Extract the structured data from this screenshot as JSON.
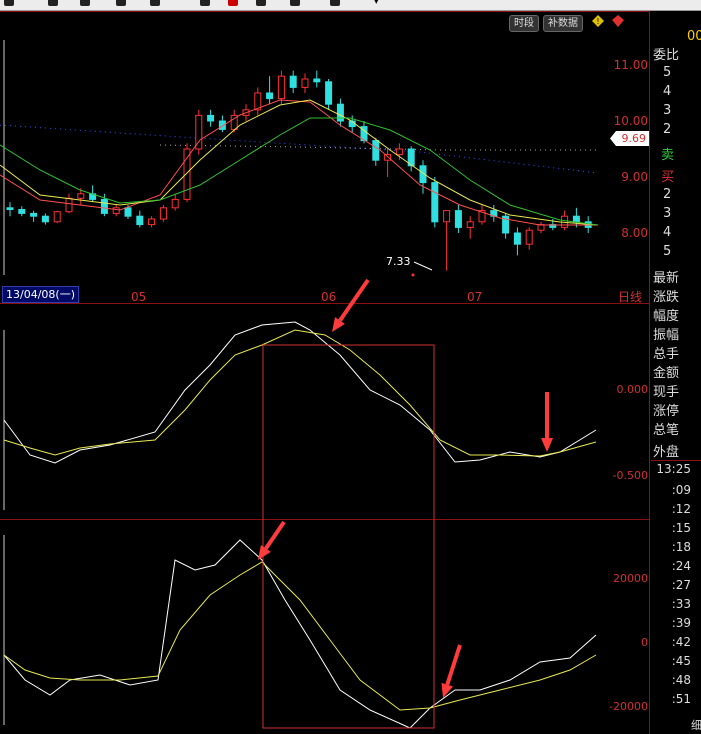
{
  "toolbar": {
    "caret": "▾"
  },
  "header_buttons": {
    "timeshare": "时段",
    "supplement": "补数据"
  },
  "stock_code": "00",
  "price_axis": [
    "11.00",
    "10.00",
    "9.00",
    "8.00"
  ],
  "current_price": "9.69",
  "min_price_label": "7.33",
  "date_box": "13/04/08(一)",
  "month_labels": [
    "05",
    "06",
    "07"
  ],
  "period_label": "日线",
  "ind1_axis": [
    "0.000",
    "-0.500"
  ],
  "ind2_axis": [
    "20000",
    "0",
    "-20000"
  ],
  "side_panel": {
    "weibi": "委比",
    "sell_levels": [
      "5",
      "4",
      "3",
      "2"
    ],
    "sell": "卖",
    "buy": "买",
    "buy_levels": [
      "2",
      "3",
      "4",
      "5"
    ],
    "fields": [
      "最新",
      "涨跌",
      "幅度",
      "振幅",
      "总手",
      "金额",
      "现手",
      "涨停",
      "总笔",
      "外盘"
    ],
    "times": [
      "13:25",
      ":09",
      ":12",
      ":15",
      ":18",
      ":24",
      ":27",
      ":33",
      ":39",
      ":42",
      ":45",
      ":48",
      ":51"
    ],
    "bottom_label": "细"
  },
  "colors": {
    "up": "#ff3030",
    "down": "#30e0e0",
    "ma_fast": "#ff5050",
    "ma_mid": "#e8e850",
    "ma_slow": "#30c030",
    "indicator_white": "#ffffff",
    "indicator_yellow": "#e8e850",
    "axis_red": "#d23030",
    "arrow": "#ff3b3b"
  }
}
